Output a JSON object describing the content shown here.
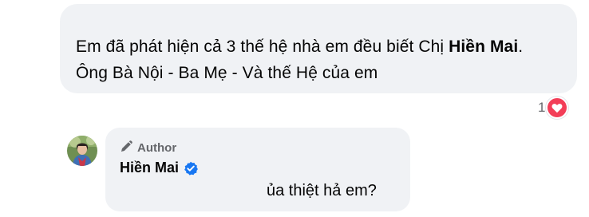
{
  "comment": {
    "line1_prefix": "Em đã phát hiện cả 3 thế hệ nhà em đều biết Chị ",
    "line1_bold": "Hiền Mai",
    "line1_suffix": ".",
    "line2": "Ông Bà Nội - Ba Mẹ - Và thế Hệ của em",
    "reaction_count": "1",
    "reaction_icon": "heart-icon",
    "reaction_color": "#f33e58"
  },
  "reply": {
    "badge_icon": "pen-icon",
    "badge_label": "Author",
    "author_name": "Hiền Mai",
    "verified_icon": "verified-badge-icon",
    "verified_color": "#1877f2",
    "text": "ủa thiệt hả em?"
  },
  "colors": {
    "bubble_bg": "#f0f2f5",
    "text": "#050505",
    "secondary_text": "#65676b"
  }
}
